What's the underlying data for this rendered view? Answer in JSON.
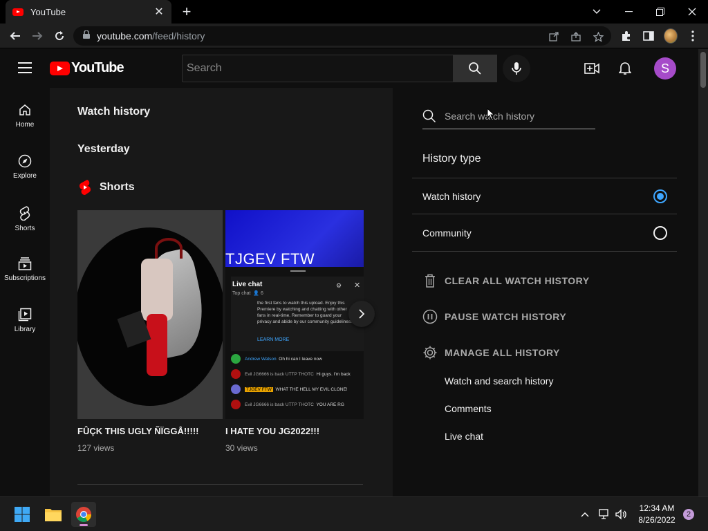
{
  "browser": {
    "tab_title": "YouTube",
    "url_host": "youtube.com",
    "url_path": "/feed/history"
  },
  "header": {
    "logo_text": "YouTube",
    "search_placeholder": "Search",
    "avatar_letter": "S"
  },
  "guide": {
    "items": [
      {
        "label": "Home",
        "icon": "home-icon"
      },
      {
        "label": "Explore",
        "icon": "compass-icon"
      },
      {
        "label": "Shorts",
        "icon": "shorts-icon"
      },
      {
        "label": "Subscriptions",
        "icon": "subscriptions-icon"
      },
      {
        "label": "Library",
        "icon": "library-icon"
      }
    ]
  },
  "main": {
    "page_title": "Watch history",
    "day_title": "Yesterday",
    "shorts_label": "Shorts",
    "shorts": [
      {
        "title": "FÛÇK THIS UGLY ÑÏGGÅ!!!!!",
        "views": "127 views"
      },
      {
        "title": "I HATE YOU JG2022!!!",
        "views": "30 views"
      }
    ],
    "thumb2": {
      "overlay_text": "TJGEV FTW",
      "live_chat_title": "Live chat",
      "live_chat_sub": "Top chat",
      "viewer_count": "6",
      "welcome_msg": "the first fans to watch this upload. Enjoy this Premiere by watching and chatting with other fans in real-time. Remember to guard your privacy and abide by our community guidelines.",
      "learn_more": "LEARN MORE",
      "chat_rows": [
        {
          "name": "Andrew Watson",
          "text": "Oh hi can I leave now",
          "color": "#2ba640"
        },
        {
          "name": "Evil JG6666 is back UTTP THOTC",
          "text": "Hi guys. I'm back",
          "color": "#b01010"
        },
        {
          "name": "TJGEV FTW",
          "text": "WHAT THE HELL MY EVIL CLONE!",
          "color": "#6a6ad0"
        },
        {
          "name": "Evil JG6666 is back UTTP THOTC",
          "text": "YOU ARE RG",
          "color": "#b01010"
        }
      ]
    }
  },
  "side": {
    "search_placeholder": "Search watch history",
    "history_type_title": "History type",
    "options": [
      {
        "label": "Watch history",
        "selected": true
      },
      {
        "label": "Community",
        "selected": false
      }
    ],
    "actions": [
      {
        "label": "CLEAR ALL WATCH HISTORY",
        "icon": "trash-icon"
      },
      {
        "label": "PAUSE WATCH HISTORY",
        "icon": "pause-icon"
      },
      {
        "label": "MANAGE ALL HISTORY",
        "icon": "gear-icon"
      }
    ],
    "manage_links": [
      "Watch and search history",
      "Comments",
      "Live chat"
    ]
  },
  "taskbar": {
    "time": "12:34 AM",
    "date": "8/26/2022",
    "notification_count": "2"
  },
  "colors": {
    "accent_blue": "#3ea6ff",
    "youtube_red": "#ff0000",
    "avatar_purple": "#a64bc9"
  }
}
